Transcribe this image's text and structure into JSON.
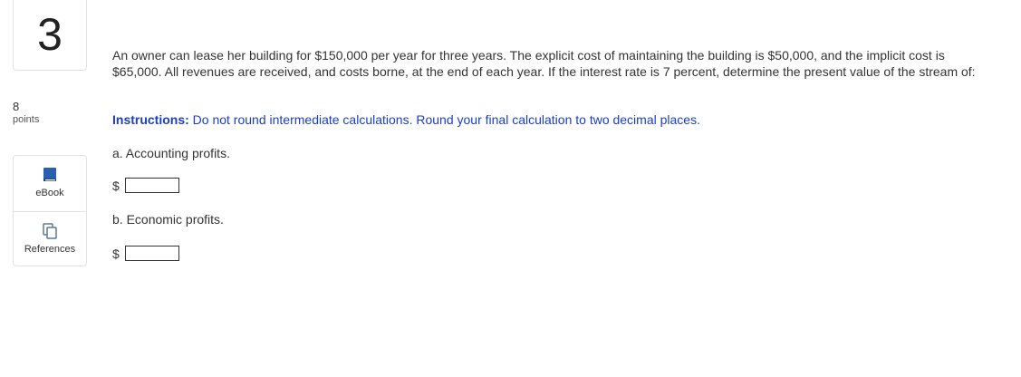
{
  "question": {
    "number": "3",
    "points_value": "8",
    "points_label": "points",
    "text": "An owner can lease her building for $150,000 per year for three years. The explicit cost of maintaining the building is $50,000, and the implicit cost is $65,000. All revenues are received, and costs borne, at the end of each year. If the interest rate is 7 percent, determine the present value of the stream of:",
    "instructions_label": "Instructions:",
    "instructions_text": " Do not round intermediate calculations. Round your final calculation to two decimal places."
  },
  "resources": {
    "ebook": {
      "label": "eBook",
      "icon": "book-icon"
    },
    "references": {
      "label": "References",
      "icon": "references-icon"
    }
  },
  "parts": [
    {
      "label": "a. Accounting profits.",
      "currency": "$",
      "value": ""
    },
    {
      "label": "b. Economic profits.",
      "currency": "$",
      "value": ""
    }
  ],
  "colors": {
    "instructions": "#1a3ec8",
    "ebook_icon": "#2a5fb0",
    "references_icon": "#5a7a9a"
  }
}
